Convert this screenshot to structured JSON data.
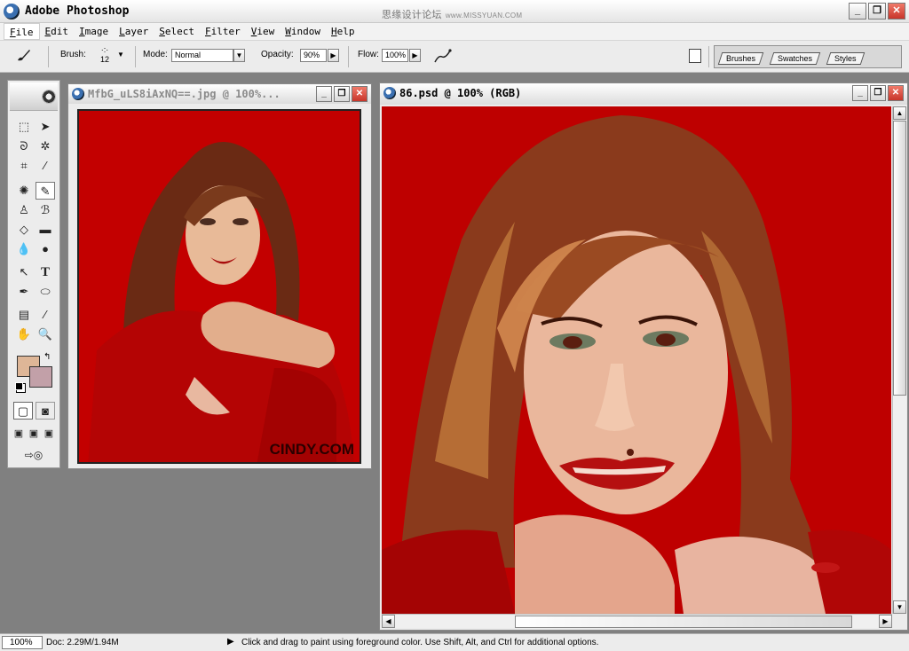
{
  "app": {
    "title": "Adobe Photoshop",
    "watermark": "思缘设计论坛",
    "watermark_url": "www.MISSYUAN.COM"
  },
  "window_controls": {
    "minimize": "_",
    "maximize": "❐",
    "close": "✕"
  },
  "menu": [
    "File",
    "Edit",
    "Image",
    "Layer",
    "Select",
    "Filter",
    "View",
    "Window",
    "Help"
  ],
  "options": {
    "brush_label": "Brush:",
    "brush_size": "12",
    "mode_label": "Mode:",
    "mode_value": "Normal",
    "opacity_label": "Opacity:",
    "opacity_value": "90%",
    "flow_label": "Flow:",
    "flow_value": "100%",
    "dropdown_arrow": "▼",
    "flyout_arrow": "▶"
  },
  "palette_well": {
    "tabs": [
      "Brushes",
      "Swatches",
      "Styles"
    ]
  },
  "toolbox": {
    "colors": {
      "foreground": "#deb697",
      "background": "#c2a0a8"
    }
  },
  "documents": [
    {
      "title": "MfbG_uLS8iAxNQ==.jpg @ 100%...",
      "watermark": "CINDY.COM",
      "active": false
    },
    {
      "title": "86.psd @ 100% (RGB)",
      "active": true
    }
  ],
  "scrollbar": {
    "up": "▲",
    "down": "▼",
    "left": "◀",
    "right": "▶"
  },
  "status": {
    "zoom": "100%",
    "doc_size": "Doc: 2.29M/1.94M",
    "arrow": "▶",
    "hint": "Click and drag to paint using foreground color.  Use Shift, Alt, and Ctrl for additional options."
  }
}
